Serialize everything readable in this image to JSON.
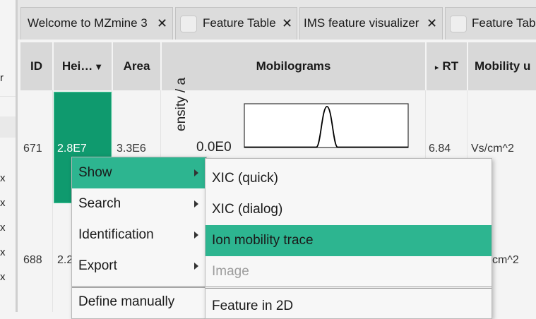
{
  "left_panel": {
    "items": [
      "r",
      "x",
      "x",
      "x",
      "x",
      "x"
    ]
  },
  "tabs": [
    {
      "label": "Welcome to MZmine 3",
      "close": "✕"
    },
    {
      "label": "Feature Table",
      "close": "✕"
    },
    {
      "label": "IMS feature visualizer",
      "close": "✕"
    },
    {
      "label": "Feature Tab",
      "close": ""
    }
  ],
  "table": {
    "columns": {
      "id": "ID",
      "height": "Hei…",
      "height_sort": "▼",
      "area": "Area",
      "mobilograms": "Mobilograms",
      "rt_arrow": "▸",
      "rt": "RT",
      "mobility": "Mobility u"
    },
    "rows": [
      {
        "id": "671",
        "height": "2.8E7",
        "area": "3.3E6",
        "rt": "6.84",
        "mobility": "Vs/cm^2"
      },
      {
        "id": "688",
        "height": "2.2",
        "area": "",
        "rt": "",
        "mobility": "cm^2"
      }
    ],
    "mobilogram": {
      "ylabel": "ensity / a",
      "y_tick": "0.0E0"
    }
  },
  "context_menu": {
    "items": [
      {
        "label": "Show",
        "submenu": true,
        "selected": true
      },
      {
        "label": "Search",
        "submenu": true
      },
      {
        "label": "Identification",
        "submenu": true
      },
      {
        "label": "Export",
        "submenu": true
      },
      {
        "label": "Define manually",
        "submenu": false
      }
    ]
  },
  "show_submenu": {
    "items": [
      {
        "label": "XIC (quick)"
      },
      {
        "label": "XIC (dialog)"
      },
      {
        "label": "Ion mobility trace",
        "selected": true
      },
      {
        "label": "Image",
        "disabled": true
      },
      {
        "label": "Feature in 2D"
      }
    ]
  },
  "colors": {
    "accent": "#2db590",
    "selected_cell": "#0f9a6e"
  }
}
